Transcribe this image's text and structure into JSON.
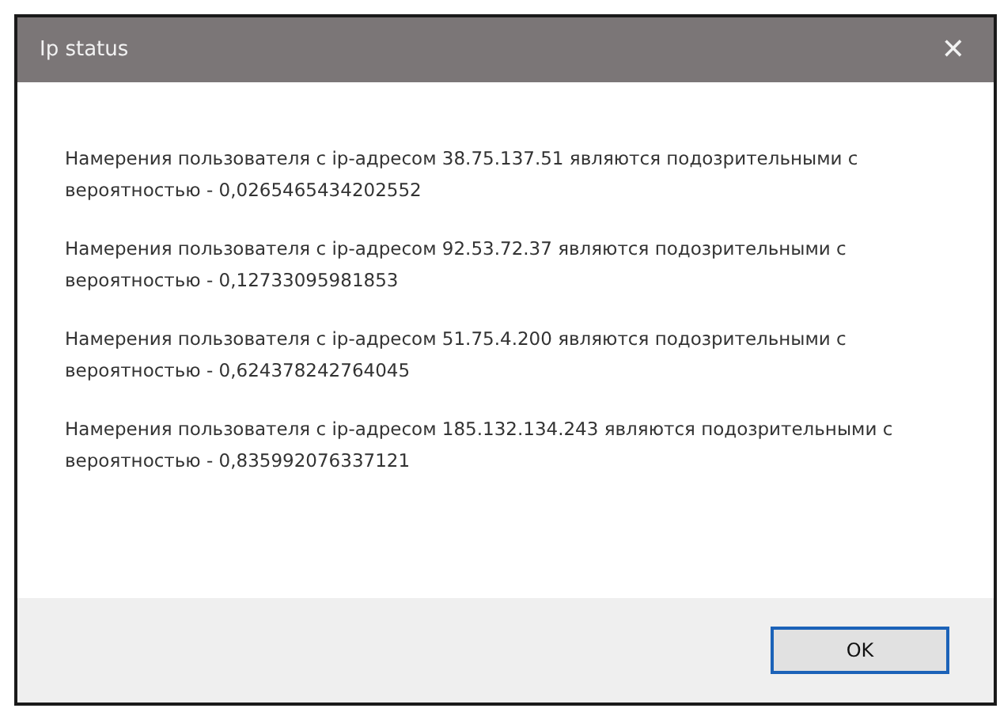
{
  "window": {
    "title": "Ip status",
    "close": "✕"
  },
  "messages": [
    "Намерения пользователя с ip-адресом 38.75.137.51 являются подозрительными с вероятностью - 0,0265465434202552",
    "Намерения пользователя с ip-адресом 92.53.72.37 являются подозрительными с вероятностью - 0,12733095981853",
    "Намерения пользователя с ip-адресом 51.75.4.200 являются подозрительными с вероятностью - 0,624378242764045",
    "Намерения пользователя с ip-адресом 185.132.134.243 являются подозрительными с вероятностью - 0,835992076337121"
  ],
  "buttons": [
    {
      "label": "OK",
      "selected": true
    }
  ]
}
